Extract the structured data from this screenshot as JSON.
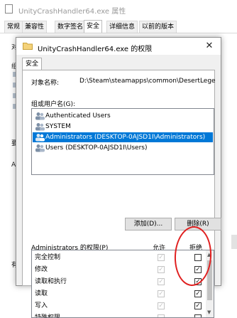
{
  "background_window": {
    "title": "UnityCrashHandler64.exe 属性",
    "tabs": [
      "常规",
      "兼容性",
      "数字签名",
      "安全",
      "详细信息",
      "以前的版本"
    ],
    "selected_tab": "安全",
    "stub_texts": [
      "对",
      "组",
      "要",
      "Au",
      "有"
    ]
  },
  "dialog": {
    "title": "UnityCrashHandler64.exe 的权限",
    "close_glyph": "✕",
    "tab": "安全",
    "object_name_label": "对象名称:",
    "object_name_value": "D:\\Steam\\steamapps\\common\\DesertLegend\\U",
    "groups_label": "组或用户名(G):",
    "groups": [
      {
        "name": "Authenticated Users",
        "selected": false
      },
      {
        "name": "SYSTEM",
        "selected": false
      },
      {
        "name": "Administrators (DESKTOP-0AJSD1I\\Administrators)",
        "selected": true
      },
      {
        "name": "Users (DESKTOP-0AJSD1I\\Users)",
        "selected": false
      }
    ],
    "add_button": "添加(D)...",
    "remove_button": "删除(R)",
    "permissions_label": "Administrators 的权限(P)",
    "allow_header": "允许",
    "deny_header": "拒绝",
    "permissions": [
      {
        "name": "完全控制",
        "allow": true,
        "deny": false
      },
      {
        "name": "修改",
        "allow": true,
        "deny": true
      },
      {
        "name": "读取和执行",
        "allow": true,
        "deny": true
      },
      {
        "name": "读取",
        "allow": true,
        "deny": true
      },
      {
        "name": "写入",
        "allow": true,
        "deny": true
      },
      {
        "name": "特殊权限",
        "allow": false,
        "deny": false
      }
    ]
  },
  "colors": {
    "selection": "#0078d7",
    "annotation": "#e02020"
  }
}
